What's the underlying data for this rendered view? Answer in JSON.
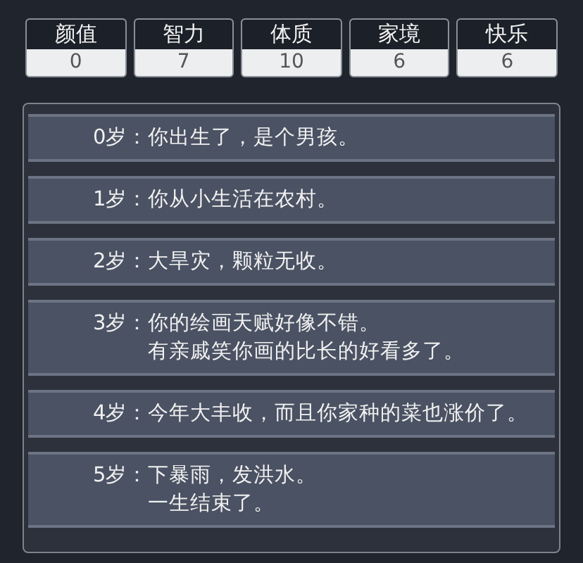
{
  "stats": [
    {
      "label": "颜值",
      "value": "0"
    },
    {
      "label": "智力",
      "value": "7"
    },
    {
      "label": "体质",
      "value": "10"
    },
    {
      "label": "家境",
      "value": "6"
    },
    {
      "label": "快乐",
      "value": "6"
    }
  ],
  "events": [
    {
      "age": "0岁：",
      "lines": [
        "你出生了，是个男孩。"
      ]
    },
    {
      "age": "1岁：",
      "lines": [
        "你从小生活在农村。"
      ]
    },
    {
      "age": "2岁：",
      "lines": [
        "大旱灾，颗粒无收。"
      ]
    },
    {
      "age": "3岁：",
      "lines": [
        "你的绘画天赋好像不错。",
        "有亲戚笑你画的比长的好看多了。"
      ]
    },
    {
      "age": "4岁：",
      "lines": [
        "今年大丰收，而且你家种的菜也涨价了。"
      ]
    },
    {
      "age": "5岁：",
      "lines": [
        "下暴雨，发洪水。",
        "一生结束了。"
      ]
    }
  ]
}
